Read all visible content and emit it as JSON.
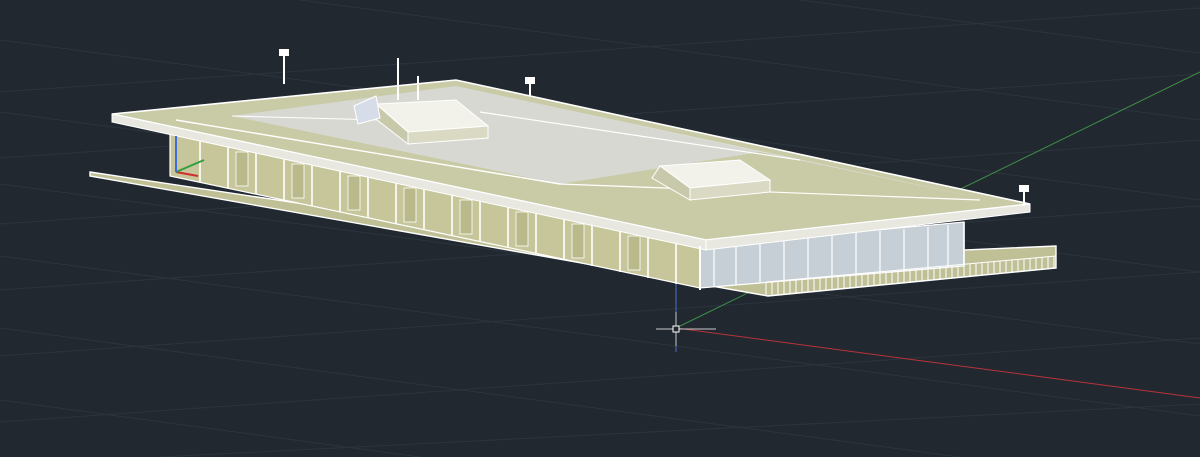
{
  "viewport": {
    "background": "#212830",
    "grid_color": "#2c343e",
    "model_line_color": "#ffffff",
    "roof_fill": "#c9cba6",
    "roof_light_fill": "#dcdcdc",
    "wall_fill": "#c6c69a",
    "window_fill": "#c6cfd6",
    "x_axis_color": "#b8333a",
    "y_axis_color": "#3e8f47",
    "z_axis_color": "#4a6fd0"
  },
  "ucs_icon": {
    "x_color": "#d22d2d",
    "y_color": "#2fa03c",
    "z_color": "#3f6be0"
  }
}
